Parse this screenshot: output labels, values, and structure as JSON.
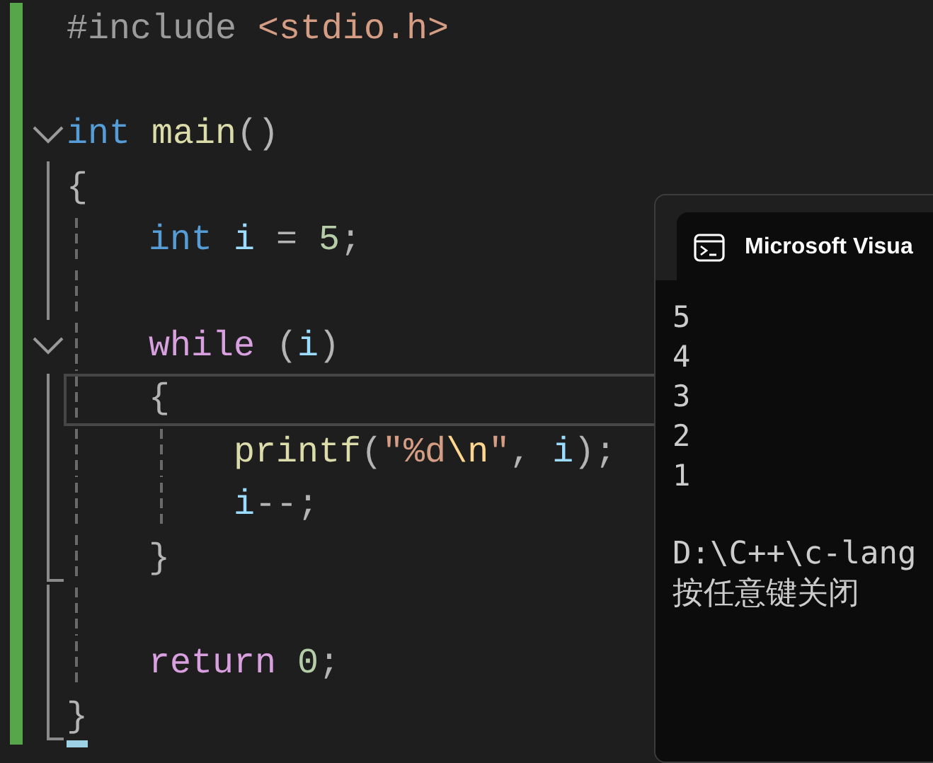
{
  "editor": {
    "lines": [
      {
        "kind": "line",
        "current": false,
        "tokens": [
          {
            "text": "#include",
            "kind": "directive"
          },
          {
            "text": " <stdio.h>",
            "kind": "string"
          }
        ]
      },
      {
        "kind": "blank"
      },
      {
        "kind": "line",
        "current": false,
        "expanded": true,
        "tokens": [
          {
            "text": "int",
            "kind": "keyword"
          },
          {
            "text": " main",
            "kind": "function"
          },
          {
            "text": "()",
            "kind": "punct"
          }
        ]
      },
      {
        "kind": "line",
        "current": false,
        "tokens": [
          {
            "text": "{",
            "kind": "punct"
          }
        ]
      },
      {
        "kind": "block",
        "children": [
          {
            "kind": "line",
            "current": false,
            "tokens": [
              {
                "text": "int",
                "kind": "keyword"
              },
              {
                "text": " i",
                "kind": "variable"
              },
              {
                "text": " =",
                "kind": "operator"
              },
              {
                "text": " 5",
                "kind": "number"
              },
              {
                "text": ";",
                "kind": "punct"
              }
            ]
          },
          {
            "kind": "blank"
          },
          {
            "kind": "line",
            "current": false,
            "expanded": true,
            "tokens": [
              {
                "text": "while",
                "kind": "control"
              },
              {
                "text": " (",
                "kind": "punct"
              },
              {
                "text": "i",
                "kind": "variable"
              },
              {
                "text": ")",
                "kind": "punct"
              }
            ]
          },
          {
            "kind": "line",
            "current": true,
            "tokens": [
              {
                "text": "{",
                "kind": "punct"
              }
            ]
          },
          {
            "kind": "block",
            "children": [
              {
                "kind": "line",
                "current": false,
                "tokens": [
                  {
                    "text": "printf",
                    "kind": "function"
                  },
                  {
                    "text": "(",
                    "kind": "punct"
                  },
                  {
                    "text": "\"%d",
                    "kind": "string"
                  },
                  {
                    "text": "\\n",
                    "kind": "escape"
                  },
                  {
                    "text": "\"",
                    "kind": "string"
                  },
                  {
                    "text": ",",
                    "kind": "punct"
                  },
                  {
                    "text": " i",
                    "kind": "variable"
                  },
                  {
                    "text": ");",
                    "kind": "punct"
                  }
                ]
              },
              {
                "kind": "line",
                "current": false,
                "tokens": [
                  {
                    "text": "i",
                    "kind": "variable"
                  },
                  {
                    "text": "--;",
                    "kind": "punct"
                  }
                ]
              }
            ]
          },
          {
            "kind": "line",
            "current": false,
            "tokens": [
              {
                "text": "}",
                "kind": "punct"
              }
            ]
          },
          {
            "kind": "blank"
          },
          {
            "kind": "line",
            "current": false,
            "tokens": [
              {
                "text": "return",
                "kind": "control"
              },
              {
                "text": " 0",
                "kind": "number"
              },
              {
                "text": ";",
                "kind": "punct"
              }
            ]
          }
        ]
      },
      {
        "kind": "line",
        "current": false,
        "caret": true,
        "tokens": [
          {
            "text": "}",
            "kind": "punct"
          }
        ]
      }
    ]
  },
  "console": {
    "title": "Microsoft Visua",
    "output": [
      "5",
      "4",
      "3",
      "2",
      "1"
    ],
    "messages": [
      "D:\\C++\\c-lang",
      "按任意键关闭"
    ]
  }
}
